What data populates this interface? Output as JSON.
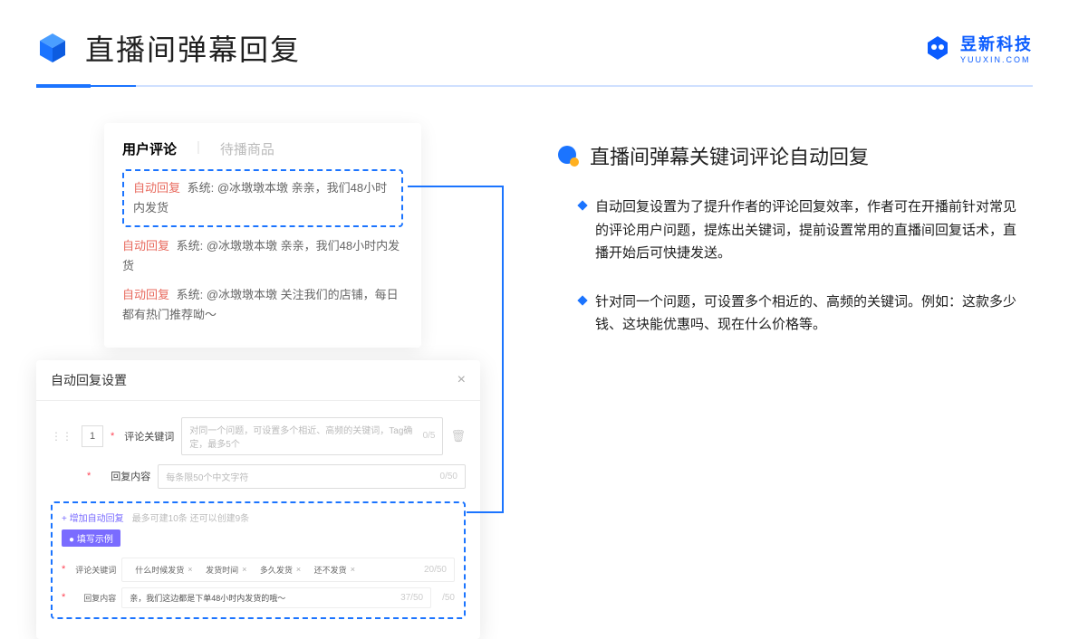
{
  "header": {
    "title": "直播间弹幕回复",
    "logo_cn": "昱新科技",
    "logo_en": "YUUXIN.COM"
  },
  "comment_panel": {
    "tab1": "用户评论",
    "tab2": "待播商品",
    "items": [
      {
        "badge": "自动回复",
        "text": "系统: @冰墩墩本墩 亲亲，我们48小时内发货"
      },
      {
        "badge": "自动回复",
        "text": "系统: @冰墩墩本墩 亲亲，我们48小时内发货"
      },
      {
        "badge": "自动回复",
        "text": "系统: @冰墩墩本墩 关注我们的店铺，每日都有热门推荐呦～"
      }
    ]
  },
  "settings": {
    "title": "自动回复设置",
    "row_num": "1",
    "keyword_label": "评论关键词",
    "keyword_placeholder": "对同一个问题，可设置多个相近、高频的关键词，Tag确定，最多5个",
    "keyword_counter": "0/5",
    "content_label": "回复内容",
    "content_placeholder": "每条限50个中文字符",
    "content_counter": "0/50",
    "add_link": "+ 增加自动回复",
    "add_hint": "最多可建10条 还可以创建9条",
    "example_badge": "● 填写示例",
    "example_kw_label": "评论关键词",
    "example_tags": [
      "什么时候发货",
      "发货时间",
      "多久发货",
      "还不发货"
    ],
    "example_kw_counter": "20/50",
    "example_ct_label": "回复内容",
    "example_ct_value": "亲，我们这边都是下单48小时内发货的哦～",
    "example_ct_counter": "37/50",
    "outer_counter": "/50"
  },
  "right": {
    "section_title": "直播间弹幕关键词评论自动回复",
    "bullets": [
      "自动回复设置为了提升作者的评论回复效率，作者可在开播前针对常见的评论用户问题，提炼出关键词，提前设置常用的直播间回复话术，直播开始后可快捷发送。",
      "针对同一个问题，可设置多个相近的、高频的关键词。例如：这款多少钱、这块能优惠吗、现在什么价格等。"
    ]
  }
}
